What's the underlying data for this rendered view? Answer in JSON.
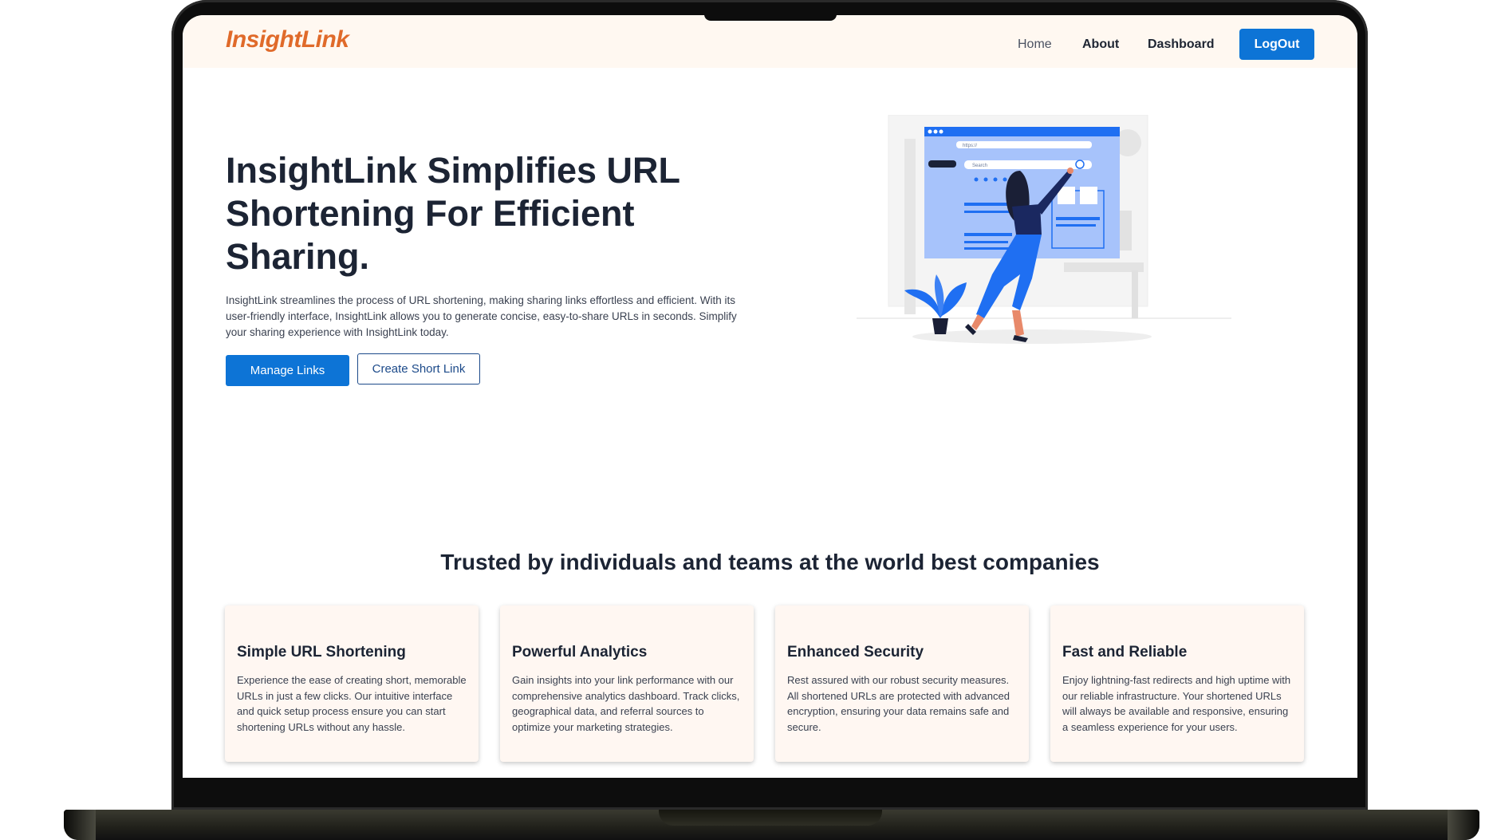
{
  "navbar": {
    "logo": "InsightLink",
    "links": [
      "Home",
      "About",
      "Dashboard"
    ],
    "logout_label": "LogOut"
  },
  "hero": {
    "title": "InsightLink Simplifies URL Shortening For Efficient Sharing.",
    "description": "InsightLink streamlines the process of URL shortening, making sharing links effortless and efficient. With its user-friendly interface, InsightLink allows you to generate concise, easy-to-share URLs in seconds. Simplify your sharing experience with InsightLink today.",
    "primary_button": "Manage Links",
    "secondary_button": "Create Short Link",
    "illustration": {
      "url_text": "https://",
      "search_placeholder": "Search"
    }
  },
  "trusted": {
    "title": "Trusted by individuals and teams at the world best companies",
    "cards": [
      {
        "title": "Simple URL Shortening",
        "text": "Experience the ease of creating short, memorable URLs in just a few clicks. Our intuitive interface and quick setup process ensure you can start shortening URLs without any hassle."
      },
      {
        "title": "Powerful Analytics",
        "text": "Gain insights into your link performance with our comprehensive analytics dashboard. Track clicks, geographical data, and referral sources to optimize your marketing strategies."
      },
      {
        "title": "Enhanced Security",
        "text": "Rest assured with our robust security measures. All shortened URLs are protected with advanced encryption, ensuring your data remains safe and secure."
      },
      {
        "title": "Fast and Reliable",
        "text": "Enjoy lightning-fast redirects and high uptime with our reliable infrastructure. Your shortened URLs will always be available and responsive, ensuring a seamless experience for your users."
      }
    ]
  },
  "colors": {
    "brand": "#e06a2a",
    "primary": "#0d74d6",
    "navbar_bg": "#fff8f1",
    "card_bg": "#fff7f2"
  }
}
